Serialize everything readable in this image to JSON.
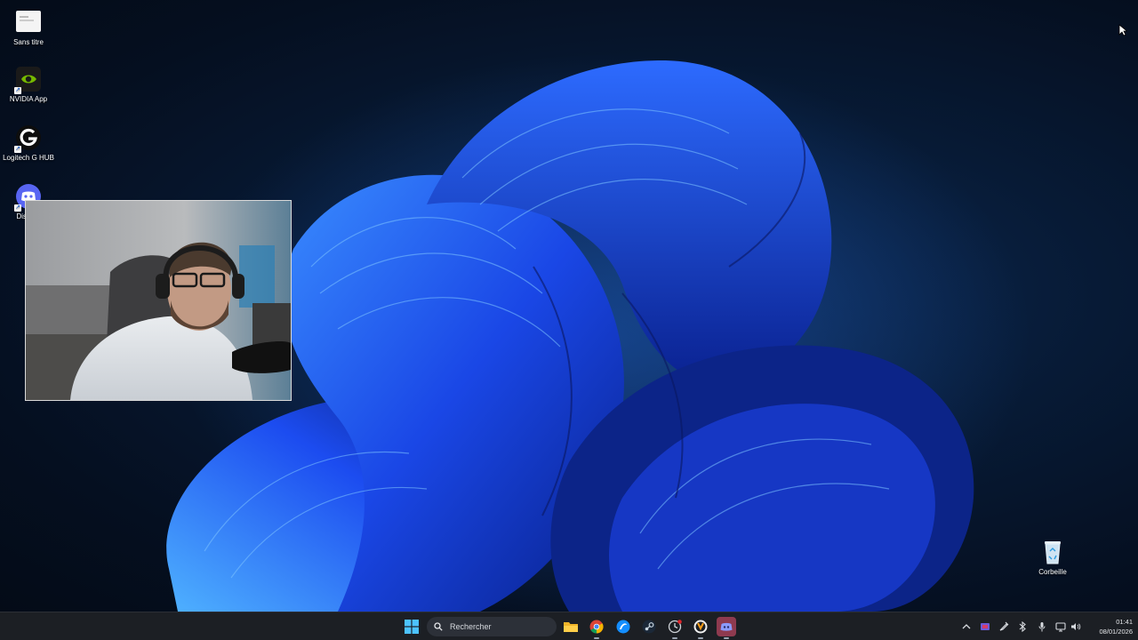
{
  "desktop": {
    "icons": [
      {
        "label": "Sans titre",
        "icon": "document-icon"
      },
      {
        "label": "NVIDIA App",
        "icon": "nvidia-icon"
      },
      {
        "label": "Logitech G HUB",
        "icon": "logitech-g-icon"
      },
      {
        "label": "Discord",
        "icon": "discord-icon"
      }
    ],
    "recycle_bin": {
      "label": "Corbeille",
      "icon": "recycle-bin-icon"
    }
  },
  "webcam": {
    "content": "webcam-overlay"
  },
  "taskbar": {
    "search_placeholder": "Rechercher",
    "apps": [
      "start-icon",
      "file-explorer-icon",
      "chrome-icon",
      "battle-net-icon",
      "steam-icon",
      "app-clock-icon",
      "overwatch-icon",
      "discord-icon"
    ],
    "tray": {
      "time": "01:41",
      "date": "08/01/2026"
    }
  },
  "colors": {
    "wallpaper_accent": "#1f5cff",
    "taskbar": "#1c1f24",
    "nvidia": "#76b900",
    "discord": "#5865f2"
  }
}
